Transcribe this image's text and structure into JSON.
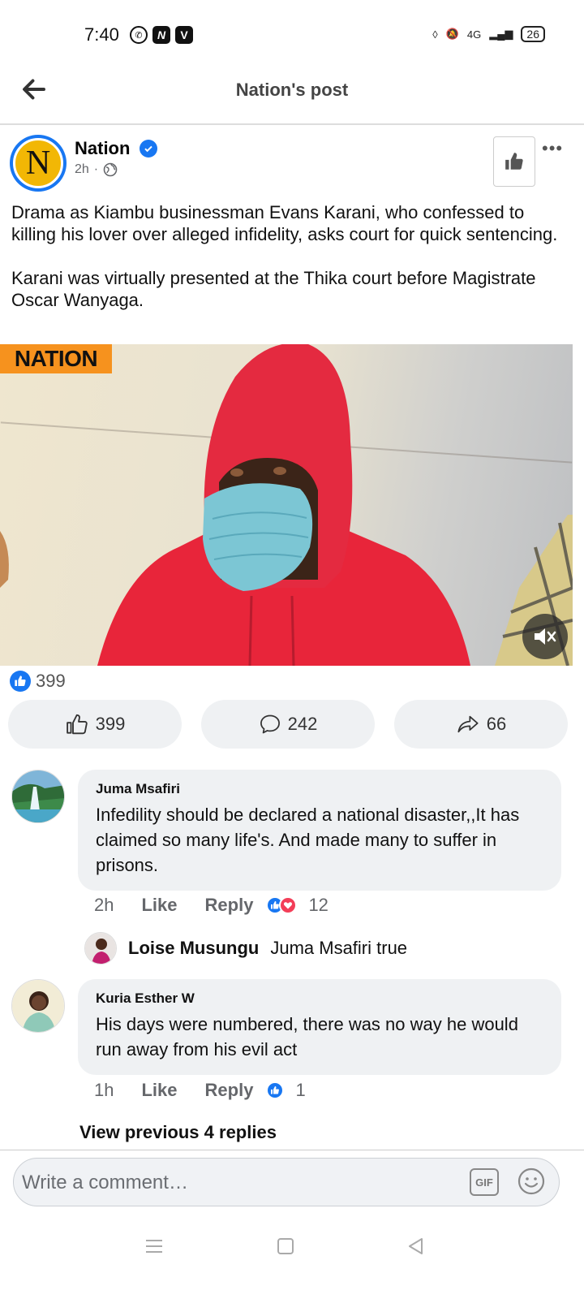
{
  "status_bar": {
    "time": "7:40",
    "battery": "26",
    "network": "4G"
  },
  "header": {
    "title": "Nation's post"
  },
  "post": {
    "page_name": "Nation",
    "avatar_letter": "N",
    "time": "2h",
    "text": "Drama as Kiambu businessman Evans Karani, who confessed to killing his lover over alleged infidelity, asks court for quick sentencing.\n\nKarani was virtually presented at the Thika court before Magistrate Oscar Wanyaga.",
    "video_badge": "NATION",
    "reaction_count": "399",
    "actions": {
      "like_count": "399",
      "comment_count": "242",
      "share_count": "66"
    }
  },
  "comments": [
    {
      "author": "Juma Msafiri",
      "text": "Infedility should be declared a national disaster,,It has claimed so many life's. And made many to suffer in prisons.",
      "time": "2h",
      "like_label": "Like",
      "reply_label": "Reply",
      "reaction_count": "12"
    },
    {
      "author": "Kuria Esther W",
      "text": "His days were numbered, there was no way he would run away from his evil act",
      "time": "1h",
      "like_label": "Like",
      "reply_label": "Reply",
      "reaction_count": "1"
    }
  ],
  "reply_preview": {
    "author": "Loise Musungu",
    "text": "Juma Msafiri true"
  },
  "view_previous": "View previous 4 replies",
  "composer": {
    "placeholder": "Write a comment…",
    "gif_label": "GIF"
  },
  "colors": {
    "accent": "#1877f2",
    "love": "#f33e58",
    "bubble": "#eff1f3",
    "nation_orange": "#f6921e",
    "nation_yellow": "#f2b705"
  }
}
